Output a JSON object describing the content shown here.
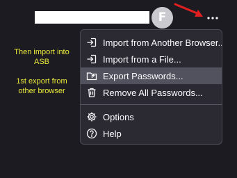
{
  "header": {
    "avatar_letter": "F",
    "menu_button_icon": "ellipsis-icon"
  },
  "annotation": {
    "line1": "Then import into ASB",
    "line2": "1st export from other browser",
    "color": "#ecec3a"
  },
  "menu": {
    "items": [
      {
        "label": "Import from Another Browser...",
        "icon": "import-icon"
      },
      {
        "label": "Import from a File...",
        "icon": "import-file-icon"
      },
      {
        "label": "Export Passwords...",
        "icon": "export-folder-icon",
        "hovered": true
      },
      {
        "label": "Remove All Passwords...",
        "icon": "trash-icon"
      },
      {
        "label": "Options",
        "icon": "gear-icon"
      },
      {
        "label": "Help",
        "icon": "help-icon"
      }
    ]
  },
  "colors": {
    "background": "#1c1b22",
    "menu_background": "#2b2a33",
    "hover_background": "#52525e",
    "arrow": "#e02020"
  }
}
